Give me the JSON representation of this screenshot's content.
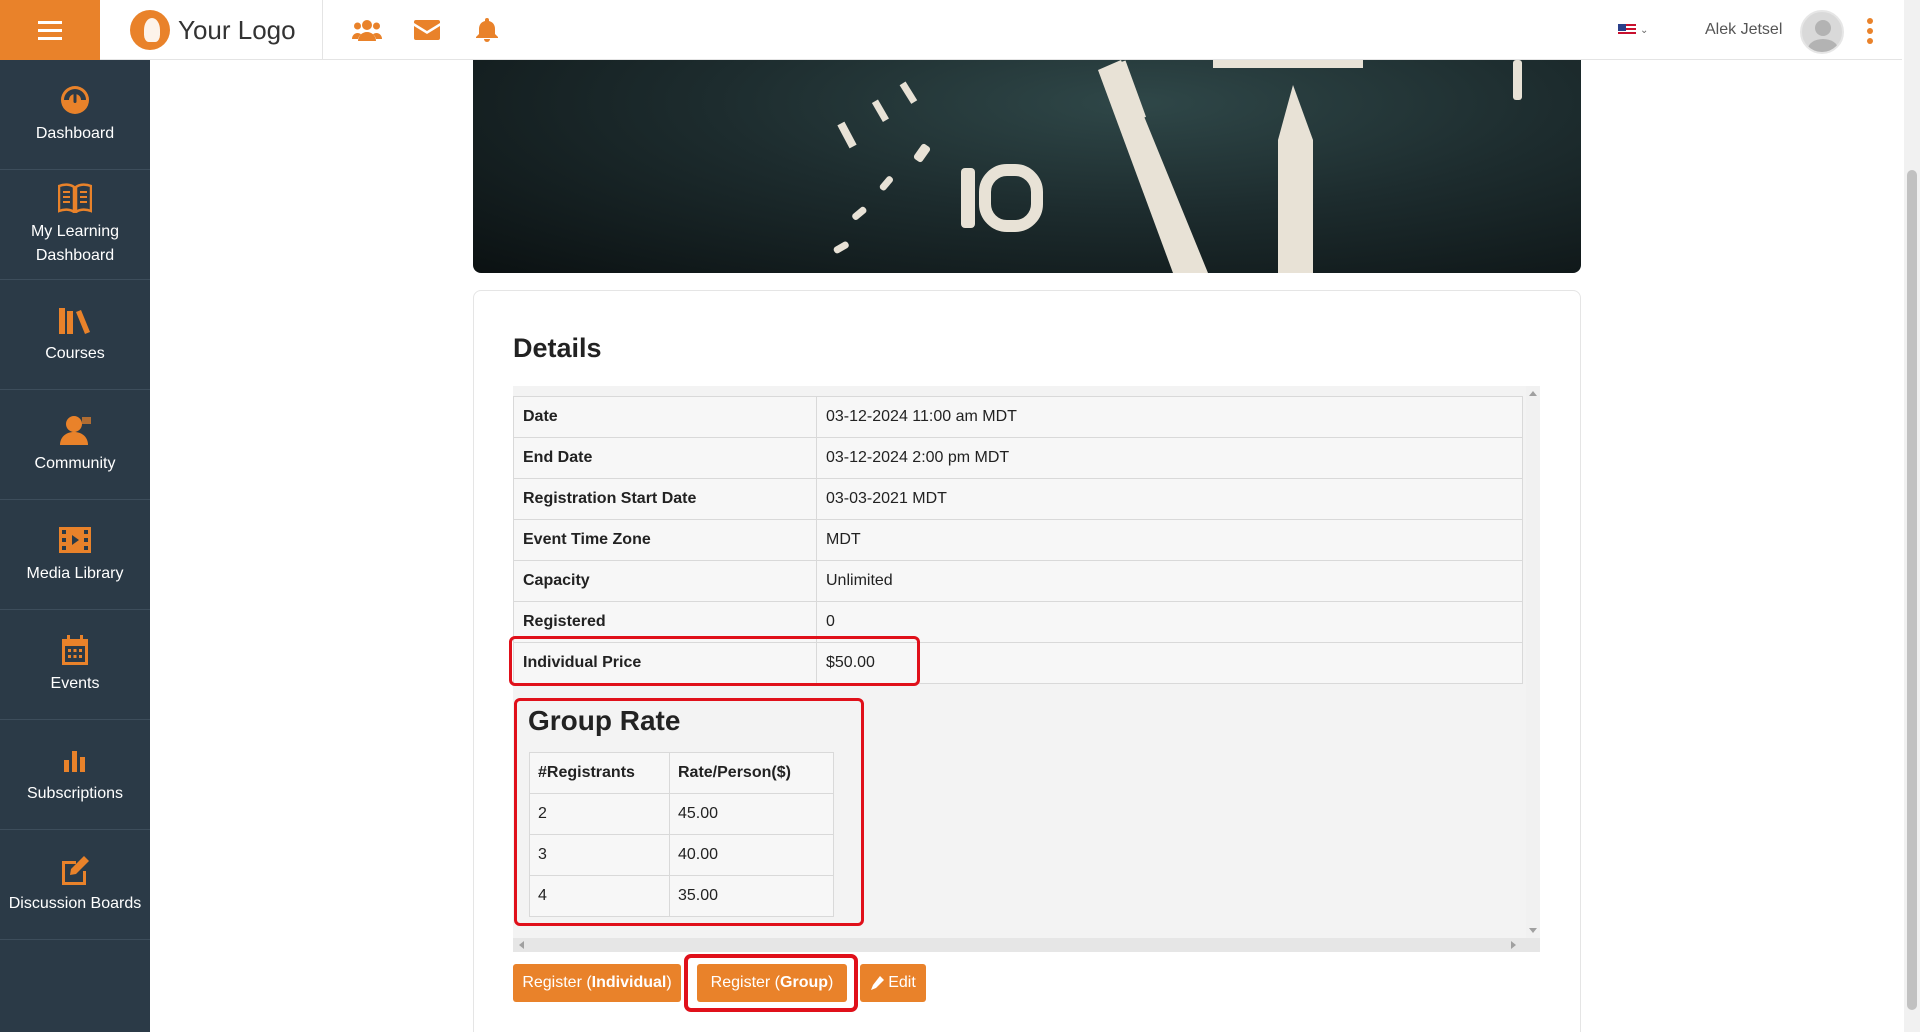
{
  "header": {
    "logo_text": "Your Logo",
    "user_name": "Alek Jetsel",
    "icons": [
      "people-icon",
      "mail-icon",
      "bell-icon"
    ],
    "language": "en-US"
  },
  "sidebar": {
    "items": [
      {
        "label": "Dashboard",
        "icon": "dashboard-gauge-icon"
      },
      {
        "label": "My Learning Dashboard",
        "icon": "open-book-icon"
      },
      {
        "label": "Courses",
        "icon": "books-icon"
      },
      {
        "label": "Community",
        "icon": "community-user-icon"
      },
      {
        "label": "Media Library",
        "icon": "film-icon"
      },
      {
        "label": "Events",
        "icon": "calendar-icon"
      },
      {
        "label": "Subscriptions",
        "icon": "bar-chart-icon"
      },
      {
        "label": "Discussion Boards",
        "icon": "edit-note-icon"
      }
    ]
  },
  "hero": {
    "clock_numeral": "10"
  },
  "details": {
    "title": "Details",
    "rows": [
      {
        "key": "Date",
        "value": "03-12-2024 11:00 am MDT"
      },
      {
        "key": "End Date",
        "value": "03-12-2024 2:00 pm MDT"
      },
      {
        "key": "Registration Start Date",
        "value": "03-03-2021 MDT"
      },
      {
        "key": "Event Time Zone",
        "value": "MDT"
      },
      {
        "key": "Capacity",
        "value": "Unlimited"
      },
      {
        "key": "Registered",
        "value": "0"
      },
      {
        "key": "Individual Price",
        "value": "$50.00"
      }
    ]
  },
  "group_rate": {
    "title": "Group Rate",
    "headers": [
      "#Registrants",
      "Rate/Person($)"
    ],
    "rows": [
      [
        "2",
        "45.00"
      ],
      [
        "3",
        "40.00"
      ],
      [
        "4",
        "35.00"
      ]
    ]
  },
  "actions": {
    "register_individual_prefix": "Register (",
    "register_individual_bold": "Individual",
    "register_individual_suffix": ")",
    "register_group_prefix": "Register (",
    "register_group_bold": "Group",
    "register_group_suffix": ")",
    "edit_label": "Edit"
  },
  "colors": {
    "accent": "#e9822a",
    "sidebar_bg": "#2b3a47",
    "highlight": "#e0101a"
  }
}
